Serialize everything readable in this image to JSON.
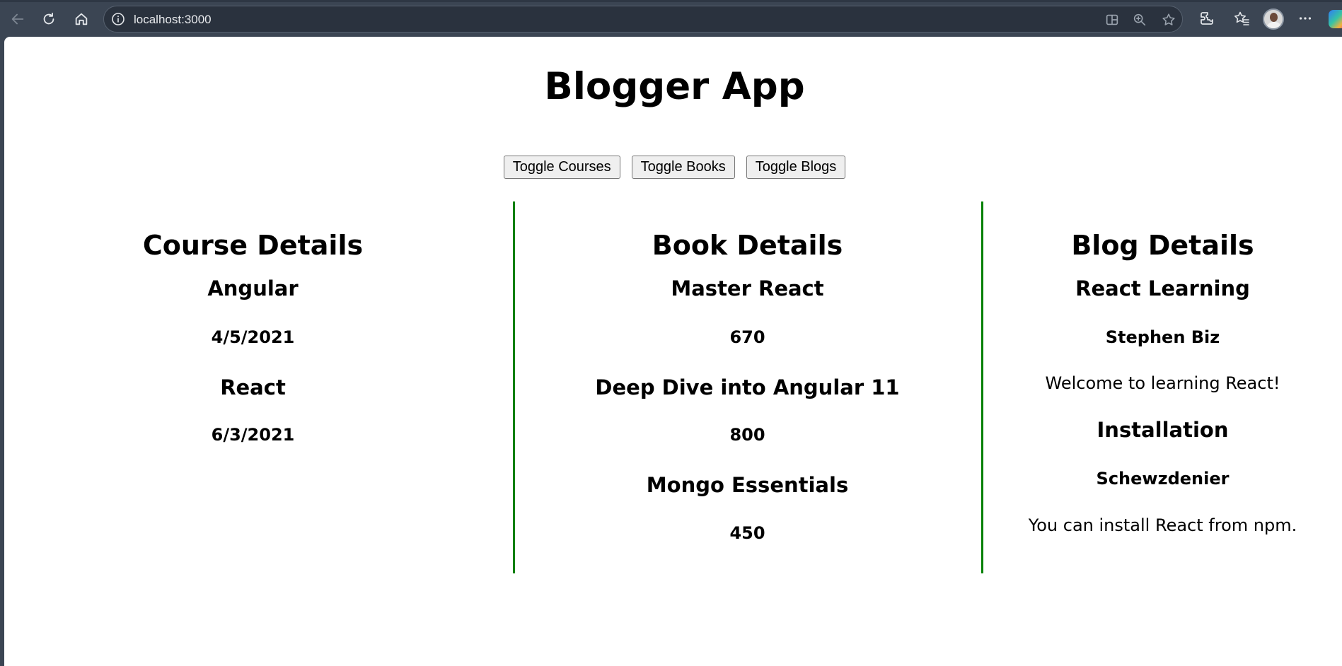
{
  "browser": {
    "url": "localhost:3000",
    "icons": [
      "back-icon",
      "refresh-icon",
      "home-icon",
      "info-icon",
      "split-screen-icon",
      "zoom-icon",
      "favorite-star-icon",
      "extensions-icon",
      "favorites-icon",
      "profile-avatar",
      "more-icon",
      "copilot-icon"
    ]
  },
  "app": {
    "title": "Blogger App",
    "buttons": {
      "courses": "Toggle Courses",
      "books": "Toggle Books",
      "blogs": "Toggle Blogs"
    },
    "accent_color": "#008000"
  },
  "courses": {
    "title": "Course Details",
    "items": [
      {
        "name": "Angular",
        "date": "4/5/2021"
      },
      {
        "name": "React",
        "date": "6/3/2021"
      }
    ]
  },
  "books": {
    "title": "Book Details",
    "items": [
      {
        "name": "Master React",
        "price": "670"
      },
      {
        "name": "Deep Dive into Angular 11",
        "price": "800"
      },
      {
        "name": "Mongo Essentials",
        "price": "450"
      }
    ]
  },
  "blogs": {
    "title": "Blog Details",
    "items": [
      {
        "title": "React Learning",
        "author": "Stephen Biz",
        "content": "Welcome to learning React!"
      },
      {
        "title": "Installation",
        "author": "Schewzdenier",
        "content": "You can install React from npm."
      }
    ]
  }
}
